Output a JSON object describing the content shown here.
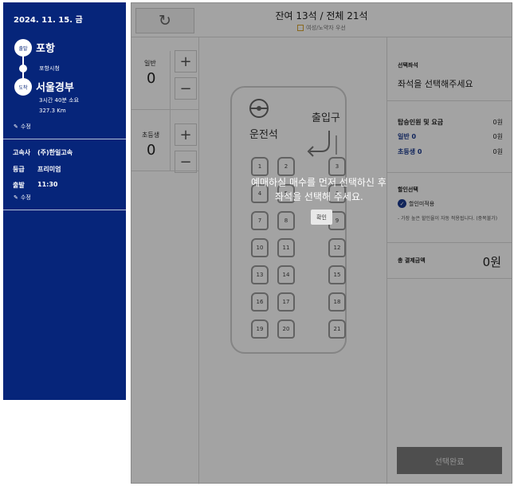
{
  "sidebar": {
    "date": "2024. 11. 15. 금",
    "origin": {
      "badge": "출발",
      "city": "포항"
    },
    "stop": "포항시청",
    "destination": {
      "badge": "도착",
      "city": "서울경부"
    },
    "duration": "3시간 40분 소요",
    "distance": "327.3 Km",
    "edit_label_1": "수정",
    "company_key": "고속사",
    "company_val": "(주)한일고속",
    "grade_key": "등급",
    "grade_val": "프리미엄",
    "departure_key": "출발",
    "departure_val": "11:30",
    "edit_label_2": "수정"
  },
  "header": {
    "refresh_icon": "↻",
    "seat_summary": "잔여 13석 / 전체 21석",
    "preference": "여성/노약자 우선"
  },
  "passengers": {
    "general_label": "일반",
    "general_count": "0",
    "child_label": "초등생",
    "child_count": "0",
    "plus": "+",
    "minus": "−"
  },
  "bus": {
    "driver_label": "운전석",
    "entrance_label": "출입구",
    "seats": [
      "1",
      "2",
      "3",
      "4",
      "5",
      "6",
      "7",
      "8",
      "9",
      "10",
      "11",
      "12",
      "13",
      "14",
      "15",
      "16",
      "17",
      "18",
      "19",
      "20",
      "21"
    ]
  },
  "right_panel": {
    "selected_title": "선택좌석",
    "selected_prompt": "좌석을 선택해주세요",
    "fare_title": "탑승인원 및 요금",
    "fare_total": "0원",
    "general_label": "일반 0",
    "general_fare": "0원",
    "child_label": "초등생 0",
    "child_fare": "0원",
    "discount_title": "할인선택",
    "discount_option": "할인미적용",
    "discount_note": "- 가장 높은 할인율이 자동 적용됩니다. (중복불가)",
    "total_title": "총 결제금액",
    "total_value": "0원",
    "complete_button": "선택완료"
  },
  "modal": {
    "line1": "예매하실 매수를 먼저 선택하신 후",
    "line2": "좌석을 선택해 주세요.",
    "confirm": "확인"
  },
  "colors": {
    "sidebar_bg": "#06257a",
    "accent_blue": "#1b3a8f"
  }
}
